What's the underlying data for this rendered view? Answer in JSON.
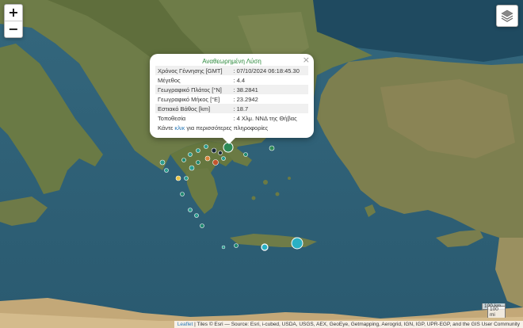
{
  "map": {
    "zoom_in_label": "+",
    "zoom_out_label": "−",
    "layers_icon": "layers-icon",
    "colors": {
      "sea": "#2e5f74",
      "land": "#6f7d4a",
      "popup_title": "#2c8a3c",
      "link": "#2a7ab8"
    }
  },
  "popup": {
    "title": "Αναθεωρημένη Λύση",
    "close_label": "×",
    "rows": [
      {
        "label": "Χρόνος Γέννησης [GMT]",
        "value": ": 07/10/2024 06:18:45.30"
      },
      {
        "label": "Μέγεθος",
        "value": ": 4.4"
      },
      {
        "label": "Γεωγραφικό Πλάτος [°N]",
        "value": ": 38.2841"
      },
      {
        "label": "Γεωγραφικό Μήκος [°E]",
        "value": ": 23.2942"
      },
      {
        "label": "Εστιακό Βάθος [km]",
        "value": ": 18.7"
      },
      {
        "label": "Τοποθεσία",
        "value": ": 4 Χλμ. ΝΝΔ της Θήβας"
      }
    ],
    "more_prefix": "Κάντε ",
    "more_link": "κλικ",
    "more_suffix": " για περισσότερες πληροφορίες"
  },
  "scale": {
    "km": "100 km",
    "mi": "100 mi"
  },
  "attribution": {
    "leaflet": "Leaflet",
    "text": " | Tiles © Esri — Source: Esri, i-cubed, USDA, USGS, AEX, GeoEye, Getmapping, Aerogrid, IGN, IGP, UPR-EGP, and the GIS User Community"
  },
  "markers": [
    {
      "color": "#2a9d8f"
    },
    {
      "color": "#2a9d8f"
    },
    {
      "color": "#1f8a70"
    },
    {
      "color": "#e8c547"
    }
  ]
}
